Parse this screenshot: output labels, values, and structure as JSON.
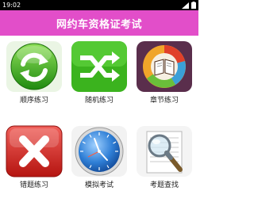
{
  "status_bar": {
    "time": "19:02"
  },
  "header": {
    "title": "网约车资格证考试"
  },
  "menu": {
    "items": [
      {
        "label": "顺序练习",
        "icon": "refresh-icon"
      },
      {
        "label": "随机练习",
        "icon": "shuffle-icon"
      },
      {
        "label": "章节练习",
        "icon": "book-chart-icon"
      },
      {
        "label": "错题练习",
        "icon": "close-x-icon"
      },
      {
        "label": "模拟考试",
        "icon": "clock-icon"
      },
      {
        "label": "考题查找",
        "icon": "magnifier-icon"
      }
    ]
  },
  "colors": {
    "header_bg": "#e24ec9",
    "green": "#35a51c",
    "red": "#d0201e",
    "blue": "#1b5fb8"
  }
}
